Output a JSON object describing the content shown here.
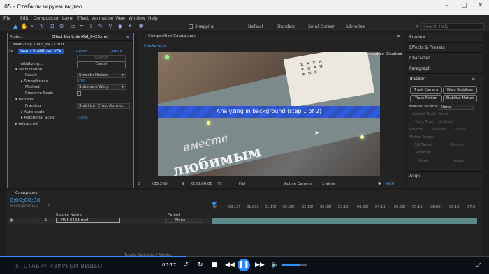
{
  "window": {
    "title": "05 - Стабилизируем видео"
  },
  "menu": [
    "File",
    "Edit",
    "Composition",
    "Layer",
    "Effect",
    "Animation",
    "View",
    "Window",
    "Help"
  ],
  "toolbar": {
    "snapping_label": "Snapping",
    "workspaces": [
      "Default",
      "Standard",
      "Small Screen",
      "Libraries"
    ],
    "search_placeholder": "Search Help"
  },
  "project_panel": {
    "tab": "Project"
  },
  "effect_controls": {
    "tab": "Effect Controls MVI_6423.mxf",
    "path": "Слайд-шоу • MVI_6423.mxf",
    "effect_name": "Warp Stabilizer VFX",
    "reset": "Reset",
    "about": "About...",
    "analyze": "Analyze",
    "initializing": "Initializing...",
    "cancel": "Cancel",
    "stabilization": "Stabilization",
    "result_label": "Result",
    "result_value": "Smooth Motion",
    "smoothness_label": "Smoothness",
    "smoothness_value": "50%",
    "method_label": "Method",
    "method_value": "Subspace Warp",
    "preserve_scale": "Preserve Scale",
    "borders": "Borders",
    "framing_label": "Framing",
    "framing_value": "Stabilize, Crop, Auto-sc",
    "autoscale": "Auto-scale",
    "additional_scale_label": "Additional Scale",
    "additional_scale_value": "100%",
    "advanced": "Advanced"
  },
  "composition": {
    "tab": "Composition Слайд-шоу",
    "subtab": "Слайд-шоу",
    "status": "Display Acceleration Disabled",
    "analyzing_banner": "Analyzing in background (step 1 of 2)",
    "footer": {
      "zoom": "(35,2%)",
      "timecode": "0;00;00;00",
      "resolution": "Full",
      "camera": "Active Camera",
      "views": "1 View",
      "exposure": "+0,0"
    }
  },
  "right_panel": {
    "items": [
      "Preview",
      "Effects & Presets",
      "Character",
      "Paragraph"
    ],
    "tracker": {
      "title": "Tracker",
      "buttons": [
        "Track Camera",
        "Warp Stabilizer",
        "Track Motion",
        "Stabilize Motion"
      ],
      "motion_source_label": "Motion Source:",
      "motion_source_value": "None",
      "current_track_label": "Current Track:",
      "current_track_value": "None",
      "track_type_label": "Track Type:",
      "track_type_value": "Stabilize",
      "checks": [
        "Position",
        "Rotation",
        "Scale"
      ],
      "motion_target": "Motion Target:",
      "edit_target": "Edit Target...",
      "options": "Options...",
      "analyze": "Analyze:",
      "reset": "Reset",
      "apply": "Apply"
    },
    "align": "Align"
  },
  "timeline": {
    "tab": "Слайд-шоу",
    "timecode": "0;00;00;00",
    "fps": "00000 (29.97 fps)",
    "source_name_header": "Source Name",
    "parent_header": "Parent",
    "layer_number": "1",
    "layer_name": "MVI_6423.mxf",
    "layer_parent": "None",
    "ruler": [
      "0f",
      "00:15f",
      "01:00f",
      "01:15f",
      "02:00f",
      "02:15f",
      "03:00f",
      "03:15f",
      "04:00f",
      "04:15f",
      "05:00f",
      "05:15f",
      "06:00f",
      "06:15f",
      "07:0"
    ],
    "toggle_label": "Toggle Switches / Modes"
  },
  "player": {
    "time": "00:17",
    "caption": "5. СТАБИЛИЗИРУЕМ ВИДЕО",
    "progress": 0.38,
    "volume": 0.7
  },
  "colors": {
    "accent": "#2f8fff",
    "banner": "#2b58e0",
    "layer_bar": "#5d8a8a"
  }
}
